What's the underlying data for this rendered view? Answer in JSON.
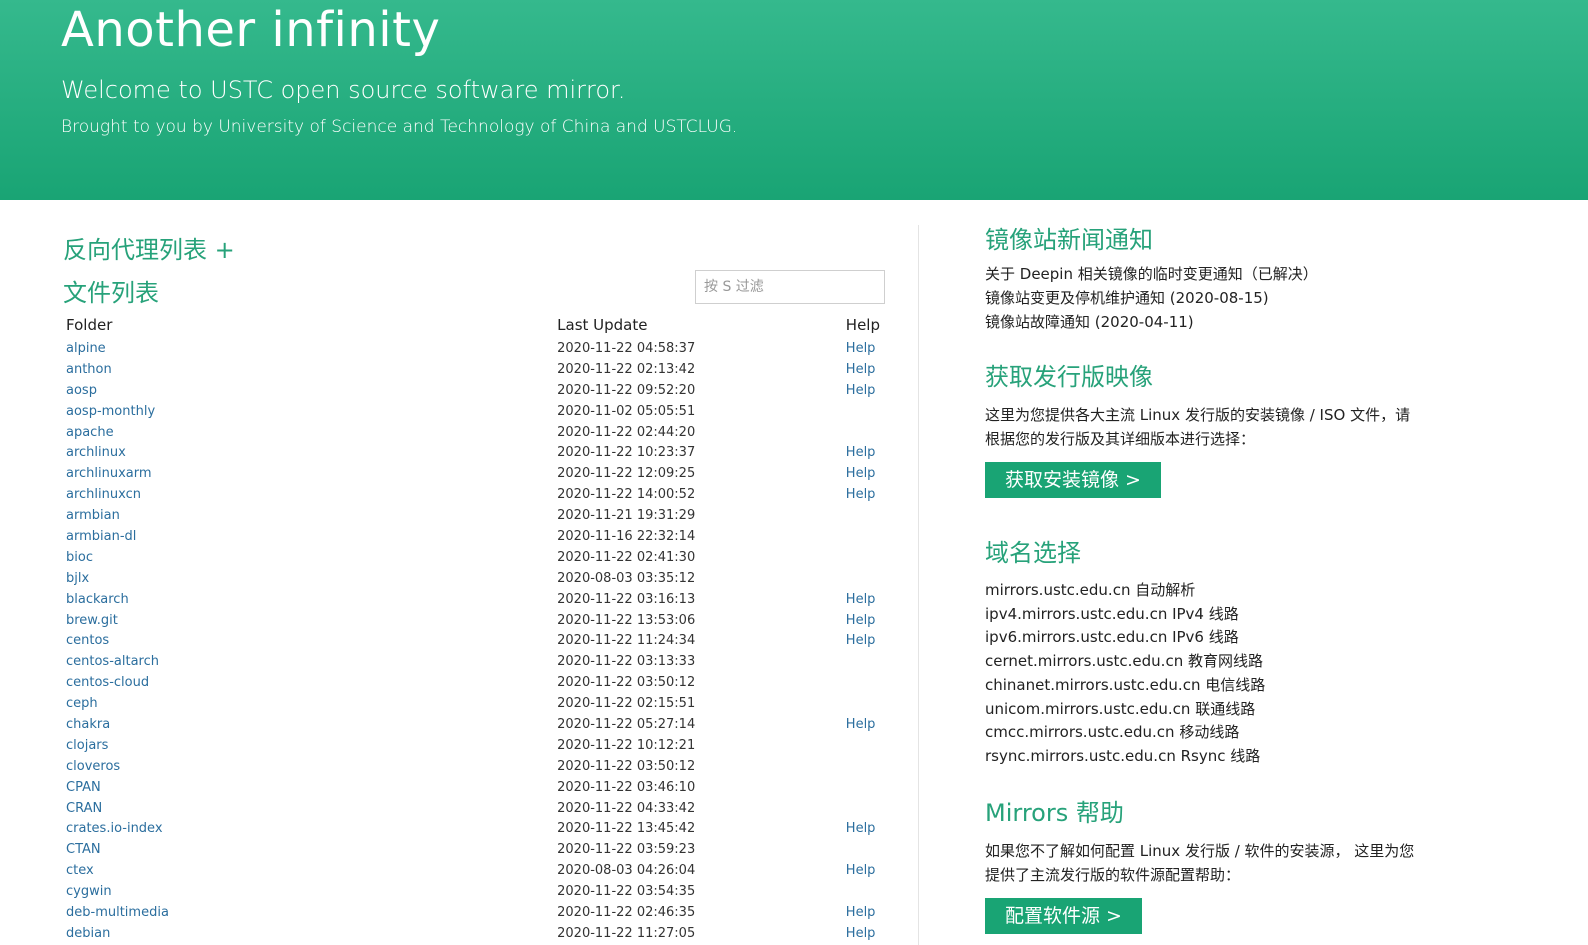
{
  "header": {
    "title": "Another infinity",
    "subtitle": "Welcome to USTC open source software mirror.",
    "tagline": "Brought to you by University of Science and Technology of China and USTCLUG."
  },
  "left": {
    "proxy_link": "反向代理列表 +",
    "files_title": "文件列表",
    "filter_placeholder": "按 S 过滤",
    "columns": {
      "folder": "Folder",
      "last_update": "Last Update",
      "help": "Help"
    },
    "rows": [
      {
        "name": "alpine",
        "date": "2020-11-22 04:58:37",
        "help": "Help"
      },
      {
        "name": "anthon",
        "date": "2020-11-22 02:13:42",
        "help": "Help"
      },
      {
        "name": "aosp",
        "date": "2020-11-22 09:52:20",
        "help": "Help"
      },
      {
        "name": "aosp-monthly",
        "date": "2020-11-02 05:05:51",
        "help": ""
      },
      {
        "name": "apache",
        "date": "2020-11-22 02:44:20",
        "help": ""
      },
      {
        "name": "archlinux",
        "date": "2020-11-22 10:23:37",
        "help": "Help"
      },
      {
        "name": "archlinuxarm",
        "date": "2020-11-22 12:09:25",
        "help": "Help"
      },
      {
        "name": "archlinuxcn",
        "date": "2020-11-22 14:00:52",
        "help": "Help"
      },
      {
        "name": "armbian",
        "date": "2020-11-21 19:31:29",
        "help": ""
      },
      {
        "name": "armbian-dl",
        "date": "2020-11-16 22:32:14",
        "help": ""
      },
      {
        "name": "bioc",
        "date": "2020-11-22 02:41:30",
        "help": ""
      },
      {
        "name": "bjlx",
        "date": "2020-08-03 03:35:12",
        "help": ""
      },
      {
        "name": "blackarch",
        "date": "2020-11-22 03:16:13",
        "help": "Help"
      },
      {
        "name": "brew.git",
        "date": "2020-11-22 13:53:06",
        "help": "Help"
      },
      {
        "name": "centos",
        "date": "2020-11-22 11:24:34",
        "help": "Help"
      },
      {
        "name": "centos-altarch",
        "date": "2020-11-22 03:13:33",
        "help": ""
      },
      {
        "name": "centos-cloud",
        "date": "2020-11-22 03:50:12",
        "help": ""
      },
      {
        "name": "ceph",
        "date": "2020-11-22 02:15:51",
        "help": ""
      },
      {
        "name": "chakra",
        "date": "2020-11-22 05:27:14",
        "help": "Help"
      },
      {
        "name": "clojars",
        "date": "2020-11-22 10:12:21",
        "help": ""
      },
      {
        "name": "cloveros",
        "date": "2020-11-22 03:50:12",
        "help": ""
      },
      {
        "name": "CPAN",
        "date": "2020-11-22 03:46:10",
        "help": ""
      },
      {
        "name": "CRAN",
        "date": "2020-11-22 04:33:42",
        "help": ""
      },
      {
        "name": "crates.io-index",
        "date": "2020-11-22 13:45:42",
        "help": "Help"
      },
      {
        "name": "CTAN",
        "date": "2020-11-22 03:59:23",
        "help": ""
      },
      {
        "name": "ctex",
        "date": "2020-08-03 04:26:04",
        "help": "Help"
      },
      {
        "name": "cygwin",
        "date": "2020-11-22 03:54:35",
        "help": ""
      },
      {
        "name": "deb-multimedia",
        "date": "2020-11-22 02:46:35",
        "help": "Help"
      },
      {
        "name": "debian",
        "date": "2020-11-22 11:27:05",
        "help": "Help"
      }
    ]
  },
  "right": {
    "news_title": "镜像站新闻通知",
    "news": [
      "关于 Deepin 相关镜像的临时变更通知（已解决）",
      "镜像站变更及停机维护通知 (2020-08-15)",
      "镜像站故障通知 (2020-04-11)"
    ],
    "iso_title": "获取发行版映像",
    "iso_line1": "这里为您提供各大主流 Linux 发行版的安装镜像 / ISO 文件，请",
    "iso_line2": "根据您的发行版及其详细版本进行选择：",
    "iso_button": "获取安装镜像 >",
    "domain_title": "域名选择",
    "domains": [
      "mirrors.ustc.edu.cn 自动解析",
      "ipv4.mirrors.ustc.edu.cn IPv4 线路",
      "ipv6.mirrors.ustc.edu.cn IPv6 线路",
      "cernet.mirrors.ustc.edu.cn 教育网线路",
      "chinanet.mirrors.ustc.edu.cn 电信线路",
      "unicom.mirrors.ustc.edu.cn 联通线路",
      "cmcc.mirrors.ustc.edu.cn 移动线路",
      "rsync.mirrors.ustc.edu.cn Rsync 线路"
    ],
    "help_title": "Mirrors 帮助",
    "help_line1": "如果您不了解如何配置 Linux 发行版 / 软件的安装源， 这里为您",
    "help_line2": "提供了主流发行版的软件源配置帮助：",
    "help_button": "配置软件源 >"
  },
  "colors": {
    "accent": "#19a474",
    "heading": "#27a27a",
    "link": "#2b6e9e"
  }
}
